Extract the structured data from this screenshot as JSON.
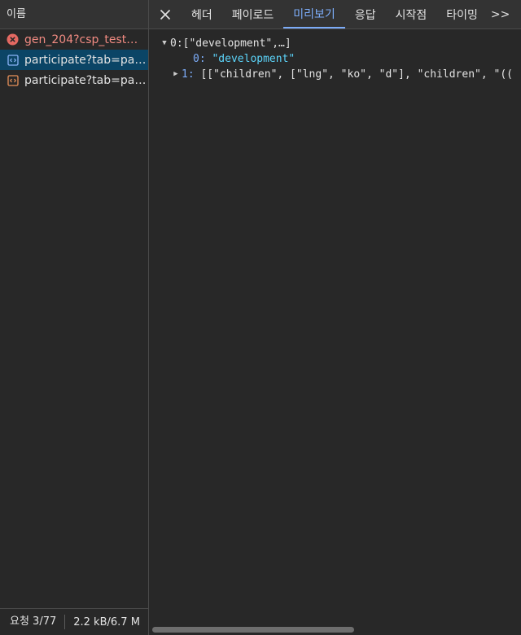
{
  "left_panel": {
    "header": "이름",
    "requests": [
      {
        "name": "gen_204?csp_test=...",
        "status": "error",
        "icon": "error-icon"
      },
      {
        "name": "participate?tab=par...",
        "status": "selected",
        "icon": "document-icon"
      },
      {
        "name": "participate?tab=par...",
        "status": "normal",
        "icon": "document-icon"
      }
    ],
    "footer": {
      "count": "요청 3/77",
      "size": "2.2 kB/6.7 M"
    }
  },
  "tabs": {
    "close_icon": "close-icon",
    "items": [
      "헤더",
      "페이로드",
      "미리보기",
      "응답",
      "시작점",
      "타이밍"
    ],
    "active": "미리보기",
    "more": ">>"
  },
  "preview": {
    "root_key": "0:",
    "root_summary": "[\"development\",…]",
    "child0_key": "0:",
    "child0_value": "\"development\"",
    "child1_key": "1:",
    "child1_value": "[[\"children\", [\"lng\", \"ko\", \"d\"], \"children\", \"(("
  },
  "colors": {
    "accent": "#7cacf8",
    "string": "#5cd5fb",
    "error": "#f28b82",
    "selected_bg": "#0b4566"
  }
}
